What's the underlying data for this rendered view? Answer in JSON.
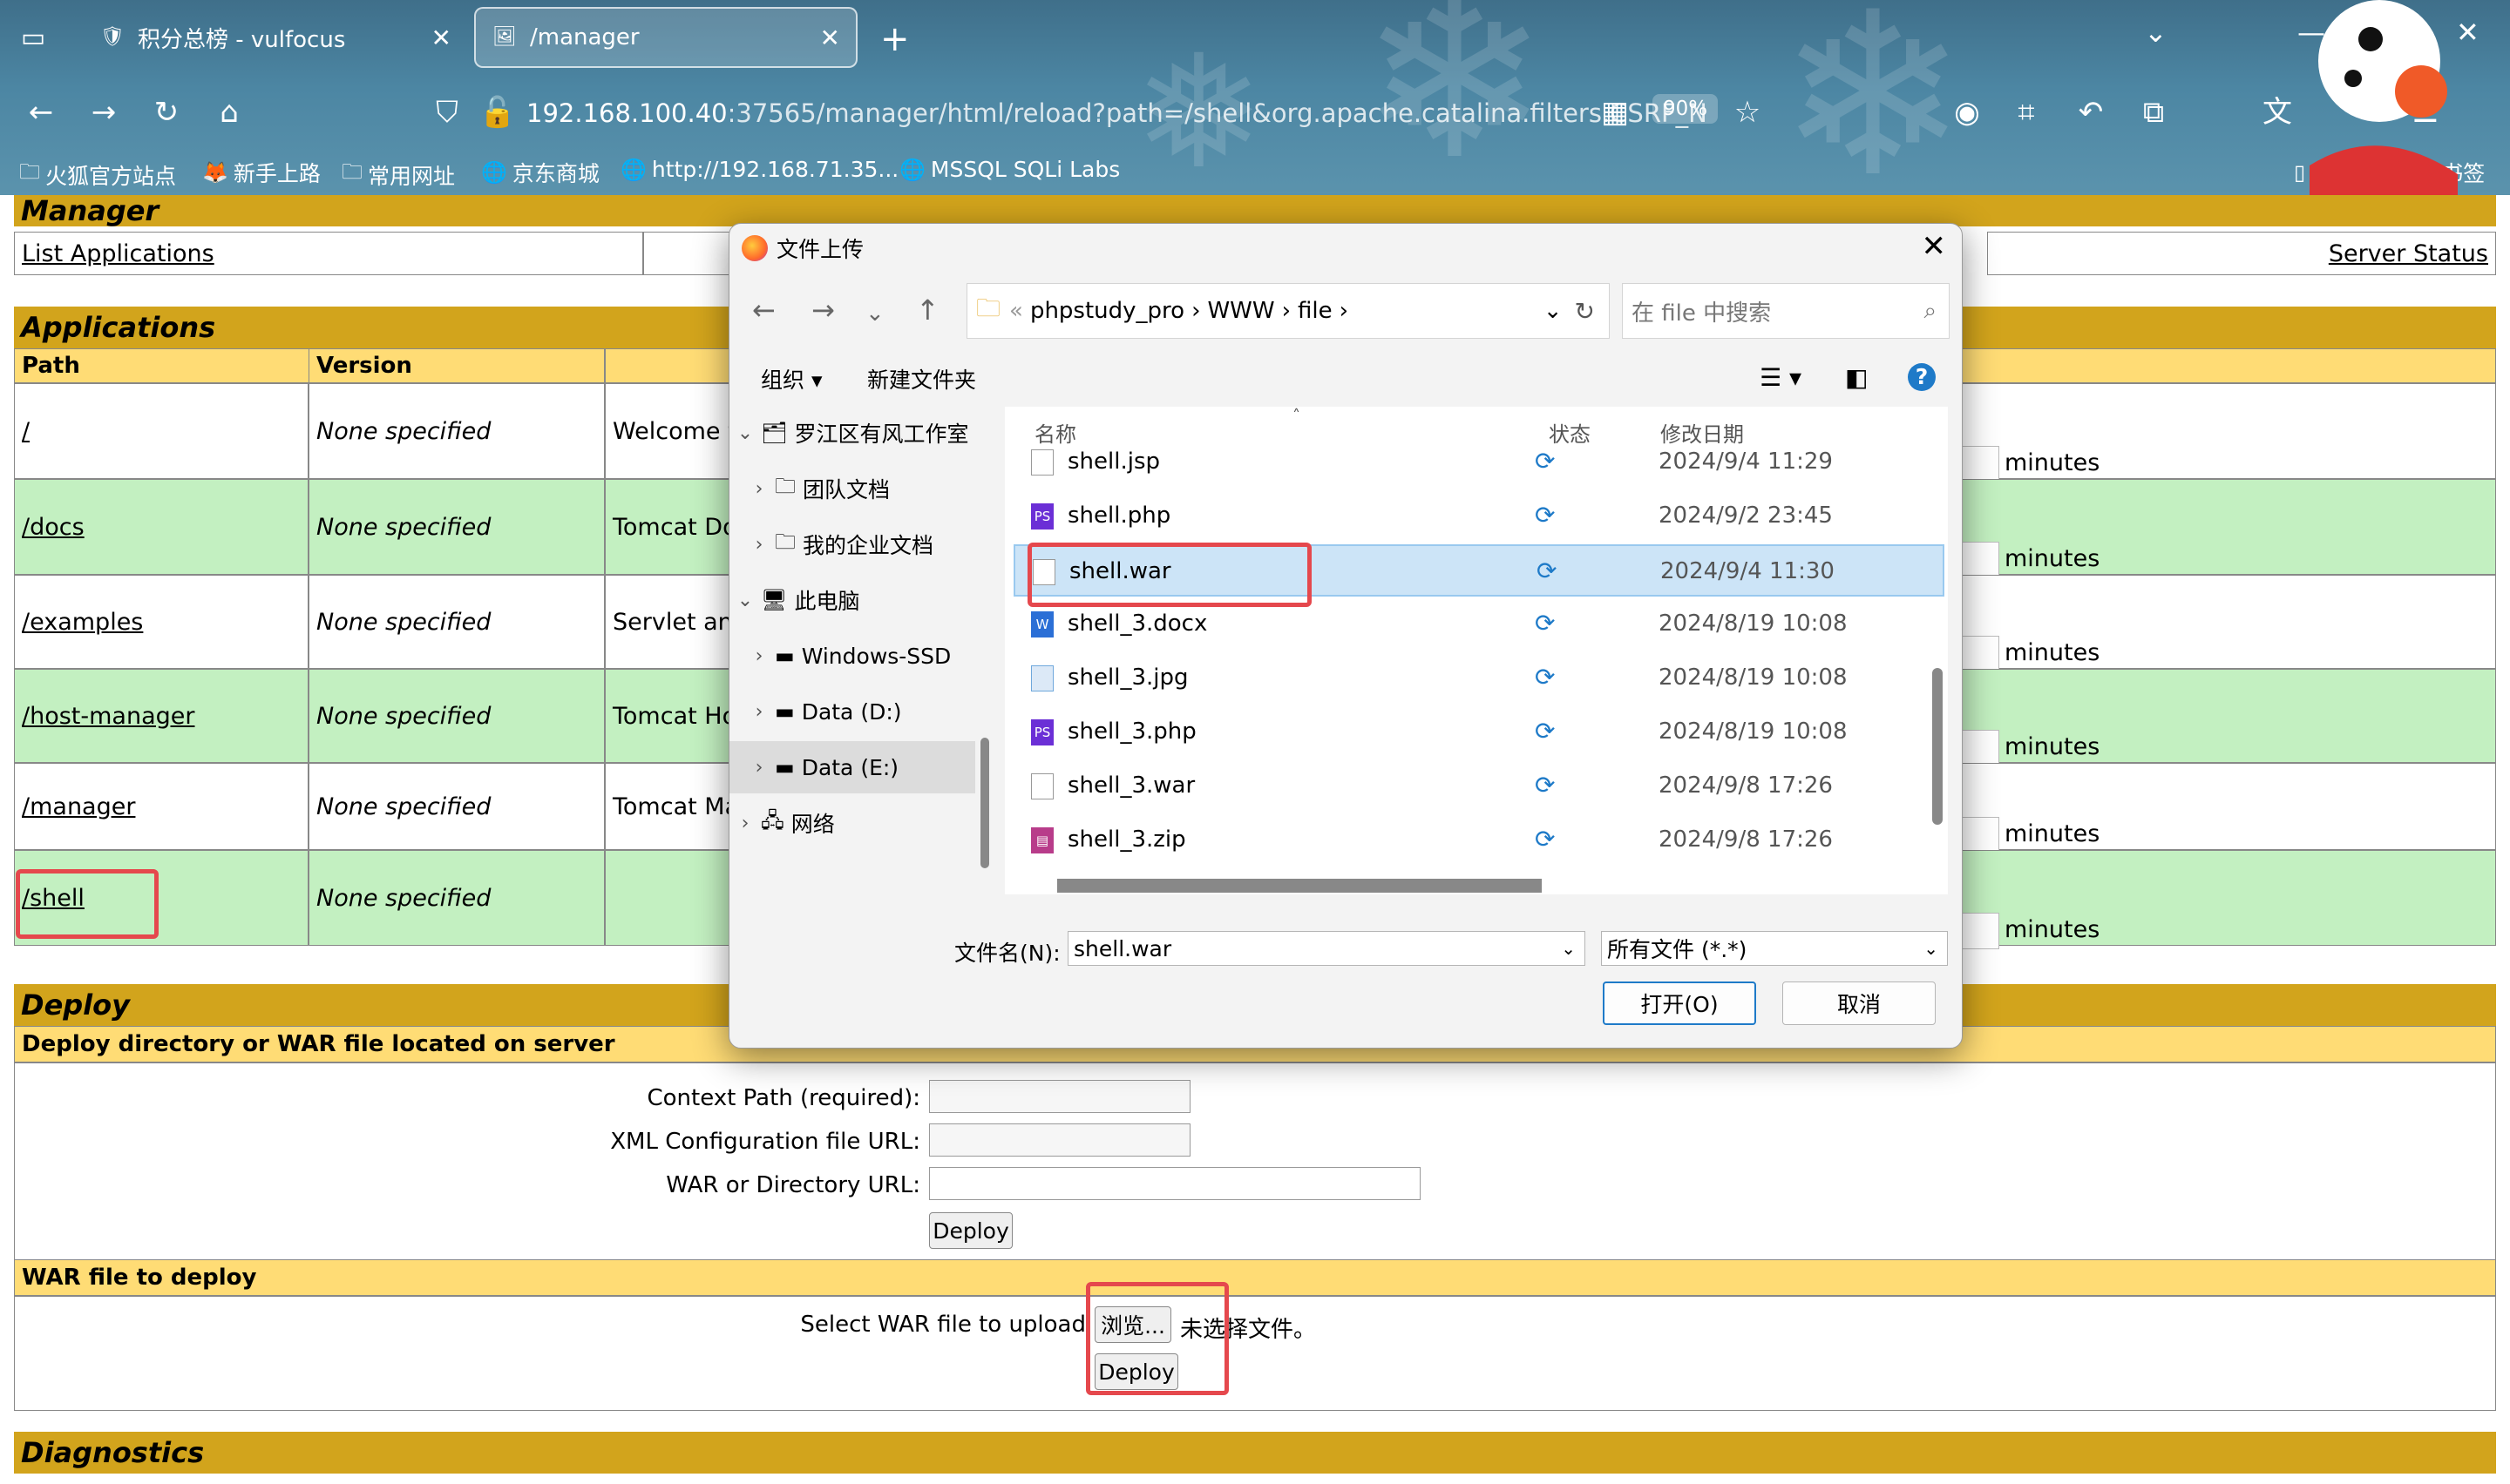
{
  "browser": {
    "tabs": [
      {
        "title": "积分总榜 - vulfocus",
        "active": false
      },
      {
        "title": "/manager",
        "active": true
      }
    ],
    "url_host": "192.168.100.40",
    "url_rest": ":37565/manager/html/reload?path=/shell&org.apache.catalina.filters.CSRF_N",
    "zoom": "90%",
    "bookmarks": [
      "火狐官方站点",
      "新手上路",
      "常用网址",
      "京东商城",
      "http://192.168.71.35...",
      "MSSQL SQLi Labs"
    ],
    "mobile_bookmarks": "移动设备上的书签"
  },
  "manager": {
    "banner": "Manager",
    "list_applications": "List Applications",
    "server_status": "Server Status"
  },
  "applications": {
    "banner": "Applications",
    "col_path": "Path",
    "col_version": "Version",
    "minutes_label": "minutes",
    "rows": [
      {
        "path": "/",
        "version": "None specified",
        "display": "Welcome to"
      },
      {
        "path": "/docs",
        "version": "None specified",
        "display": "Tomcat Doc"
      },
      {
        "path": "/examples",
        "version": "None specified",
        "display": "Servlet and"
      },
      {
        "path": "/host-manager",
        "version": "None specified",
        "display": "Tomcat Hos"
      },
      {
        "path": "/manager",
        "version": "None specified",
        "display": "Tomcat Mar"
      },
      {
        "path": "/shell",
        "version": "None specified",
        "display": ""
      }
    ]
  },
  "deploy": {
    "banner": "Deploy",
    "server_header": "Deploy directory or WAR file located on server",
    "context_path_label": "Context Path (required):",
    "xml_config_label": "XML Configuration file URL:",
    "war_dir_label": "WAR or Directory URL:",
    "deploy_button": "Deploy",
    "war_header": "WAR file to deploy",
    "select_label": "Select WAR file to upload",
    "browse_button": "浏览...",
    "no_file": "未选择文件。",
    "upload_deploy_button": "Deploy"
  },
  "diagnostics": {
    "banner": "Diagnostics"
  },
  "dialog": {
    "title": "文件上传",
    "breadcrumb": [
      "phpstudy_pro",
      "WWW",
      "file"
    ],
    "search_placeholder": "在 file 中搜索",
    "organize": "组织",
    "new_folder": "新建文件夹",
    "tree": [
      {
        "label": "罗江区有风工作室",
        "expanded": true,
        "icon": "cloud-folder-icon"
      },
      {
        "label": "团队文档",
        "expanded": false,
        "icon": "folder-icon"
      },
      {
        "label": "我的企业文档",
        "expanded": false,
        "icon": "folder-icon"
      },
      {
        "label": "此电脑",
        "expanded": true,
        "icon": "computer-icon"
      },
      {
        "label": "Windows-SSD",
        "expanded": false,
        "icon": "drive-icon"
      },
      {
        "label": "Data (D:)",
        "expanded": false,
        "icon": "drive-icon"
      },
      {
        "label": "Data (E:)",
        "expanded": false,
        "icon": "drive-icon",
        "selected": true
      },
      {
        "label": "网络",
        "expanded": false,
        "icon": "network-icon"
      }
    ],
    "columns": {
      "name": "名称",
      "status": "状态",
      "modified": "修改日期"
    },
    "files": [
      {
        "name": "shell.jsp",
        "date": "2024/9/4 11:29",
        "icon": "file-icon",
        "color": "#ffffff"
      },
      {
        "name": "shell.php",
        "date": "2024/9/2 23:45",
        "icon": "phpstorm-icon",
        "color": "#6b2fd6"
      },
      {
        "name": "shell.war",
        "date": "2024/9/4 11:30",
        "icon": "file-icon",
        "color": "#ffffff",
        "selected": true
      },
      {
        "name": "shell_3.docx",
        "date": "2024/8/19 10:08",
        "icon": "word-icon",
        "color": "#2b6fd6"
      },
      {
        "name": "shell_3.jpg",
        "date": "2024/8/19 10:08",
        "icon": "image-icon",
        "color": "#6fa8dc"
      },
      {
        "name": "shell_3.php",
        "date": "2024/8/19 10:08",
        "icon": "phpstorm-icon",
        "color": "#6b2fd6"
      },
      {
        "name": "shell_3.war",
        "date": "2024/9/8 17:26",
        "icon": "file-icon",
        "color": "#ffffff"
      },
      {
        "name": "shell_3.zip",
        "date": "2024/9/8 17:26",
        "icon": "archive-icon",
        "color": "#b83c8a"
      }
    ],
    "filename_label": "文件名(N):",
    "filename_value": "shell.war",
    "filetype_value": "所有文件 (*.*)",
    "open_button": "打开(O)",
    "cancel_button": "取消"
  }
}
